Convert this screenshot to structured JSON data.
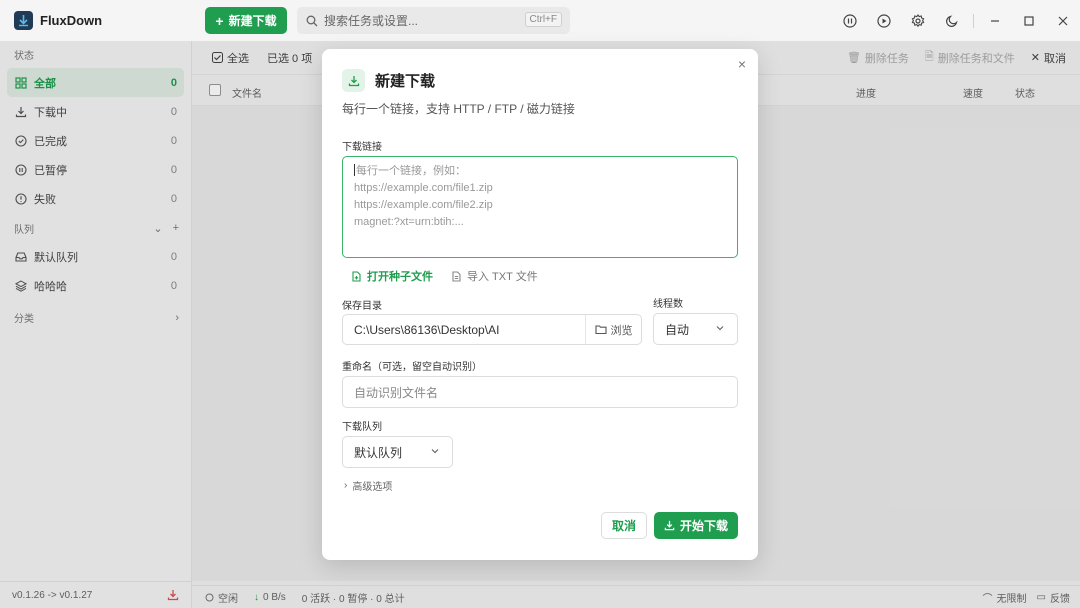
{
  "app": {
    "name": "FluxDown"
  },
  "header": {
    "new_download": "新建下载",
    "search_placeholder": "搜索任务或设置...",
    "search_shortcut": "Ctrl+F"
  },
  "sidebar": {
    "status_section": "状态",
    "status_items": [
      {
        "label": "全部",
        "count": "0",
        "icon": "grid-icon"
      },
      {
        "label": "下载中",
        "count": "0",
        "icon": "download-icon"
      },
      {
        "label": "已完成",
        "count": "0",
        "icon": "check-circle-icon"
      },
      {
        "label": "已暂停",
        "count": "0",
        "icon": "pause-circle-icon"
      },
      {
        "label": "失败",
        "count": "0",
        "icon": "alert-circle-icon"
      }
    ],
    "queue_section": "队列",
    "queue_items": [
      {
        "label": "默认队列",
        "count": "0",
        "icon": "inbox-icon"
      },
      {
        "label": "哈哈哈",
        "count": "0",
        "icon": "layers-icon"
      }
    ],
    "category_section": "分类",
    "version": "v0.1.26 -> v0.1.27"
  },
  "toolbar": {
    "select_all": "全选",
    "selected": "已选 0 项",
    "delete_task": "删除任务",
    "delete_task_files": "删除任务和文件",
    "cancel": "取消"
  },
  "table": {
    "columns": [
      "文件名",
      "进度",
      "速度",
      "状态"
    ]
  },
  "statusbar": {
    "idle": "空闲",
    "speed": "0 B/s",
    "summary": "0 活跃 · 0 暂停 · 0 总计",
    "limit": "无限制",
    "feedback": "反馈"
  },
  "dialog": {
    "title": "新建下载",
    "subtitle": "每行一个链接，支持 HTTP / FTP / 磁力链接",
    "links_label": "下载链接",
    "links_placeholder_lines": [
      "每行一个链接，例如：",
      "https://example.com/file1.zip",
      "https://example.com/file2.zip",
      "magnet:?xt=urn:btih:..."
    ],
    "open_torrent": "打开种子文件",
    "import_txt": "导入 TXT 文件",
    "save_dir_label": "保存目录",
    "save_dir_value": "C:\\Users\\86136\\Desktop\\AI",
    "browse": "浏览",
    "threads_label": "线程数",
    "threads_value": "自动",
    "rename_label": "重命名（可选，留空自动识别）",
    "rename_placeholder": "自动识别文件名",
    "queue_label": "下载队列",
    "queue_value": "默认队列",
    "advanced": "高级选项",
    "cancel": "取消",
    "start": "开始下载"
  },
  "colors": {
    "accent": "#1e9e4e",
    "accent_light": "#e0ece4"
  }
}
